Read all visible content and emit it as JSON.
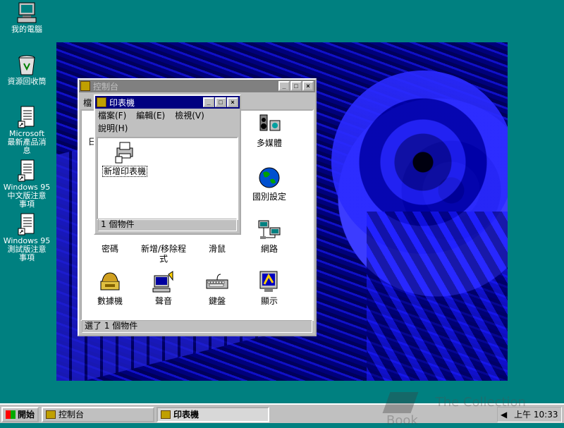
{
  "desktop": {
    "icons": [
      {
        "label": "我的電腦"
      },
      {
        "label": "資源回收筒"
      },
      {
        "label": "Microsoft\n最新產品消\n息"
      },
      {
        "label": "Windows 95\n中文版注意\n事項"
      },
      {
        "label": "Windows 95\n測試版注意\n事項"
      }
    ]
  },
  "control_panel": {
    "title": "控制台",
    "menu_partial": [
      "檔",
      "日"
    ],
    "items": [
      {
        "label": "多媒體",
        "icon": "multimedia-icon"
      },
      {
        "label": "國別設定",
        "icon": "globe-icon"
      },
      {
        "label": "密碼",
        "icon": "keys-icon"
      },
      {
        "label": "新增/移除程\n式",
        "icon": "add-remove-programs-icon"
      },
      {
        "label": "滑鼠",
        "icon": "mouse-icon"
      },
      {
        "label": "網路",
        "icon": "network-icon"
      },
      {
        "label": "數據機",
        "icon": "modem-icon"
      },
      {
        "label": "聲音",
        "icon": "sound-icon"
      },
      {
        "label": "鍵盤",
        "icon": "keyboard-icon"
      },
      {
        "label": "顯示",
        "icon": "display-icon"
      }
    ],
    "status": "選了 1 個物件"
  },
  "printers": {
    "title": "印表機",
    "menu": [
      "檔案(F)",
      "編輯(E)",
      "檢視(V)",
      "說明(H)"
    ],
    "items": [
      {
        "label": "新增印表機",
        "icon": "add-printer-icon"
      }
    ],
    "status": "1 個物件"
  },
  "taskbar": {
    "start_label": "開始",
    "buttons": [
      {
        "label": "控制台",
        "pressed": false
      },
      {
        "label": "印表機",
        "pressed": true
      }
    ],
    "clock": "上午 10:33"
  },
  "watermark": "The Collection Book",
  "colors": {
    "desktop": "#008080",
    "titlebar_active": "#000080",
    "titlebar_inactive": "#808080",
    "face": "#c0c0c0"
  }
}
